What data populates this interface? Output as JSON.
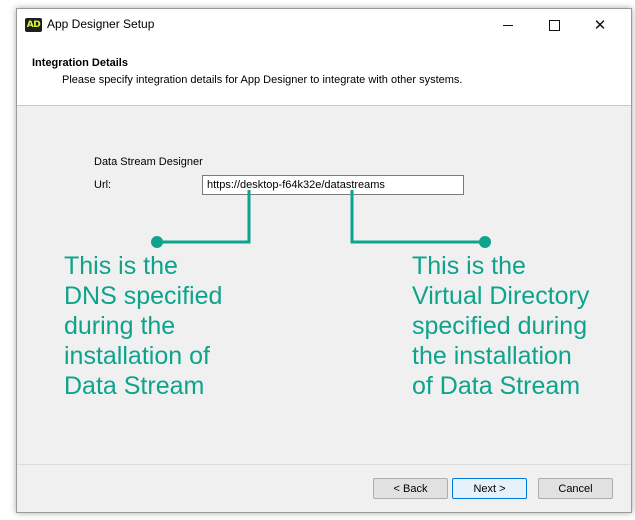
{
  "window": {
    "icon_text": "AD",
    "title": "App Designer Setup"
  },
  "header": {
    "title": "Integration Details",
    "subtitle": "Please specify integration details for App Designer to integrate with other systems."
  },
  "form": {
    "group_label": "Data Stream Designer",
    "url_label": "Url:",
    "url_value": "https://desktop-f64k32e/datastreams"
  },
  "annotations": {
    "left_lines": [
      "This is the",
      "DNS specified",
      "during the",
      "installation of",
      "Data Stream"
    ],
    "right_lines": [
      "This is the",
      "Virtual Directory",
      "specified during",
      "the installation",
      "of Data Stream"
    ],
    "color": "#0ea38d"
  },
  "buttons": {
    "back": "< Back",
    "next": "Next >",
    "cancel": "Cancel"
  },
  "icons": {
    "minimize": "minimize-icon",
    "maximize": "maximize-icon",
    "close": "close-icon"
  }
}
